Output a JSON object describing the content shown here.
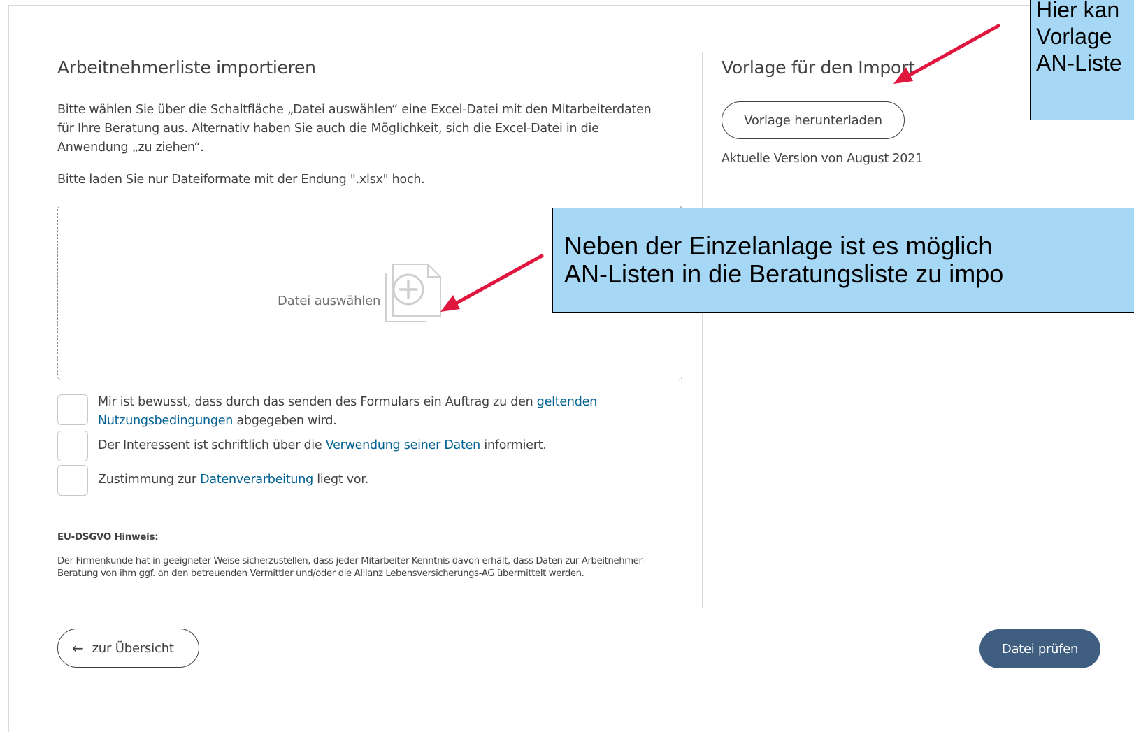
{
  "left": {
    "title": "Arbeitnehmerliste importieren",
    "intro_lines": [
      "Bitte wählen Sie über die Schaltfläche „Datei auswählen“ eine Excel-Datei mit den Mitarbeiterdaten",
      "für Ihre Beratung aus. Alternativ haben Sie auch die Möglichkeit, sich die Excel-Datei in die",
      "Anwendung „zu ziehen“."
    ],
    "format_hint": "Bitte laden Sie nur Dateiformate mit der Endung \".xlsx\" hoch.",
    "dropzone_label": "Datei auswählen",
    "checkboxes": [
      {
        "line1_before": "Mir ist bewusst, dass durch das senden des Formulars ein Auftrag zu den ",
        "line1_link": "geltenden",
        "line2_link": "Nutzungsbedingungen",
        "line2_after": " abgegeben wird."
      },
      {
        "before": "Der Interessent ist schriftlich über die ",
        "link": "Verwendung seiner Daten",
        "after": " informiert."
      },
      {
        "before": "Zustimmung zur ",
        "link": "Datenverarbeitung",
        "after": " liegt vor."
      }
    ],
    "gdpr_heading": "EU-DSGVO Hinweis:",
    "gdpr_text": "Der Firmenkunde hat in geeigneter Weise sicherzustellen, dass jeder Mitarbeiter Kenntnis davon erhält, dass Daten zur Arbeitnehmer-Beratung von ihm ggf. an den betreuenden Vermittler und/oder die Allianz Lebensversicherungs-AG übermittelt werden."
  },
  "right": {
    "title": "Vorlage für den Import",
    "download_button": "Vorlage herunterladen",
    "version_text": "Aktuelle Version von August 2021"
  },
  "footer": {
    "back_arrow": "←",
    "back_label": "zur Übersicht",
    "primary_label": "Datei prüfen"
  },
  "callouts": {
    "top_lines": [
      "Hier kan",
      "Vorlage",
      "AN-Liste"
    ],
    "middle_lines": [
      "Neben der Einzelanlage ist es möglich",
      "AN-Listen in die Beratungsliste zu impo"
    ]
  },
  "colors": {
    "link": "#006192",
    "primary_button": "#3f5e80",
    "callout_fill": "#a6d8f5",
    "annotation_arrow": "#e0163f"
  },
  "icons": {
    "dropzone": "file-add-icon",
    "back": "arrow-left-icon"
  }
}
